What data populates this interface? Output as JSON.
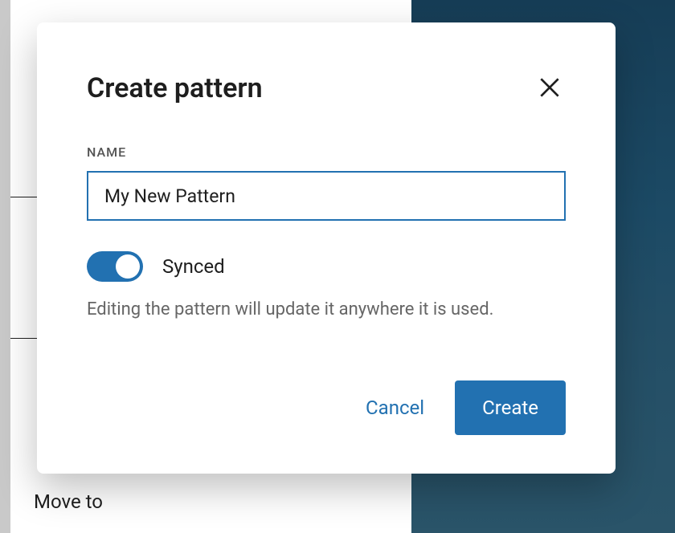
{
  "background_menu": {
    "visible_item": "Move to"
  },
  "modal": {
    "title": "Create pattern",
    "name_field": {
      "label": "NAME",
      "value": "My New Pattern"
    },
    "synced_toggle": {
      "label": "Synced",
      "on": true
    },
    "helper_text": "Editing the pattern will update it anywhere it is used.",
    "actions": {
      "cancel": "Cancel",
      "create": "Create"
    }
  }
}
